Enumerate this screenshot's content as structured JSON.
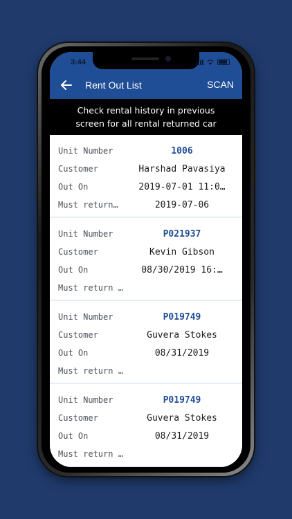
{
  "status_bar": {
    "time": "3:44"
  },
  "app_bar": {
    "title": "Rent Out List",
    "action": "SCAN"
  },
  "banner": {
    "line1": "Check rental history in previous",
    "line2": "screen for all rental returned car"
  },
  "labels": {
    "unit": "Unit Number",
    "customer": "Customer",
    "out_on": "Out On",
    "must_return_1": "Must return…",
    "must_return": "Must return by"
  },
  "rentals": [
    {
      "unit": "1006",
      "customer": "Harshad Pavasiya",
      "out_on": "2019-07-01 11:0…",
      "must_return": "2019-07-06"
    },
    {
      "unit": "P021937",
      "customer": "Kevin Gibson",
      "out_on": "08/30/2019 16:…",
      "must_return": ""
    },
    {
      "unit": "P019749",
      "customer": "Guvera Stokes",
      "out_on": "08/31/2019",
      "must_return": ""
    },
    {
      "unit": "P019749",
      "customer": "Guvera Stokes",
      "out_on": "08/31/2019",
      "must_return": ""
    }
  ],
  "colors": {
    "background": "#1f3a6b",
    "app_bar": "#1f4e96",
    "unit_number": "#1f4e96"
  }
}
